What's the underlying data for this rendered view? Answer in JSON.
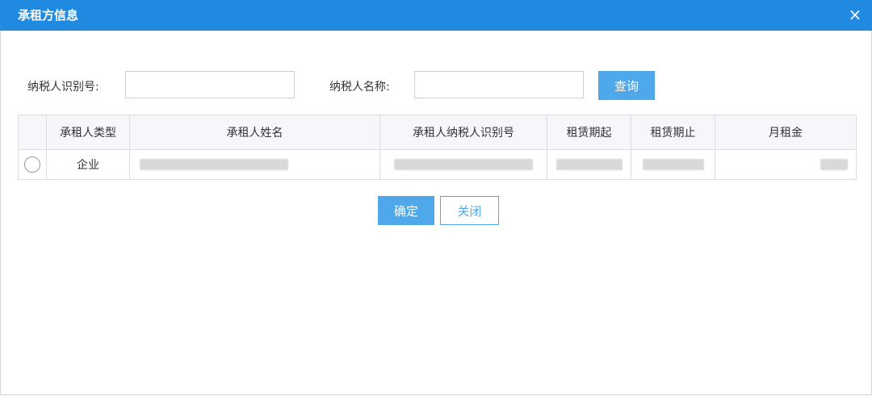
{
  "dialog": {
    "title": "承租方信息",
    "close_icon": "×"
  },
  "search": {
    "taxpayer_id_label": "纳税人识别号:",
    "taxpayer_id_value": "",
    "taxpayer_name_label": "纳税人名称:",
    "taxpayer_name_value": "",
    "query_label": "查询"
  },
  "table": {
    "columns": [
      "",
      "承租人类型",
      "承租人姓名",
      "承租人纳税人识别号",
      "租赁期起",
      "租赁期止",
      "月租金"
    ],
    "rows": [
      {
        "type": "企业"
      }
    ]
  },
  "footer": {
    "ok_label": "确定",
    "close_label": "关闭"
  },
  "colors": {
    "header_bg": "#1f8ae0",
    "button_bg": "#4fa8ea"
  }
}
